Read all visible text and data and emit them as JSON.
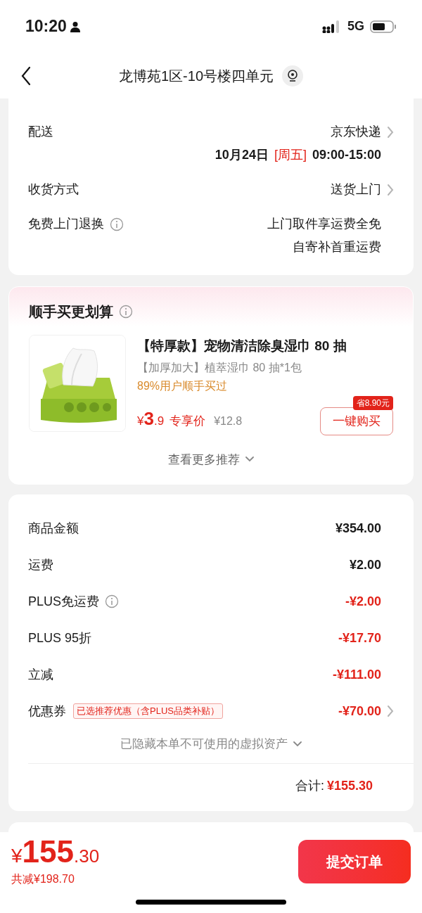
{
  "status_bar": {
    "time": "10:20",
    "network": "5G"
  },
  "header": {
    "title": "龙博苑1区-10号楼四单元"
  },
  "delivery": {
    "rows": [
      {
        "kind": "delivery",
        "label": "配送",
        "value": "京东快递",
        "date": "10月24日",
        "weekday": "[周五]",
        "time": "09:00-15:00"
      },
      {
        "kind": "select",
        "label": "收货方式",
        "value": "送货上门"
      },
      {
        "kind": "info",
        "label": "免费上门退换",
        "lines": [
          "上门取件享运费全免",
          "自寄补首重运费"
        ]
      }
    ]
  },
  "recommend": {
    "title": "顺手买更划算",
    "product": {
      "name": "【特厚款】宠物清洁除臭湿巾 80 抽",
      "spec": "【加厚加大】植萃湿巾 80 抽*1包",
      "social_proof": "89%用户顺手买过",
      "currency": "¥",
      "price_int": "3",
      "price_dec": ".9",
      "price_tag": "专享价",
      "original_price": "¥12.8",
      "save_badge": "省8.90元",
      "buy_button": "一键购买"
    },
    "more": "查看更多推荐"
  },
  "summary": {
    "rows": [
      {
        "label": "商品金额",
        "value": "¥354.00",
        "discount": false
      },
      {
        "label": "运费",
        "value": "¥2.00",
        "discount": false
      },
      {
        "label": "PLUS免运费",
        "value": "-¥2.00",
        "discount": true,
        "info": true
      },
      {
        "label": "PLUS 95折",
        "value": "-¥17.70",
        "discount": true
      },
      {
        "label": "立减",
        "value": "-¥111.00",
        "discount": true
      },
      {
        "label": "优惠券",
        "value": "-¥70.00",
        "discount": true,
        "tag": "已选推荐优惠（含PLUS品类补贴）",
        "arrow": true
      }
    ],
    "hidden_note": "已隐藏本单不可使用的虚拟资产",
    "total_label": "合计:",
    "total_value": "¥155.30"
  },
  "footer": {
    "currency": "¥",
    "price_int": "155",
    "price_dec": ".30",
    "saved": "共减¥198.70",
    "submit": "提交订单"
  }
}
